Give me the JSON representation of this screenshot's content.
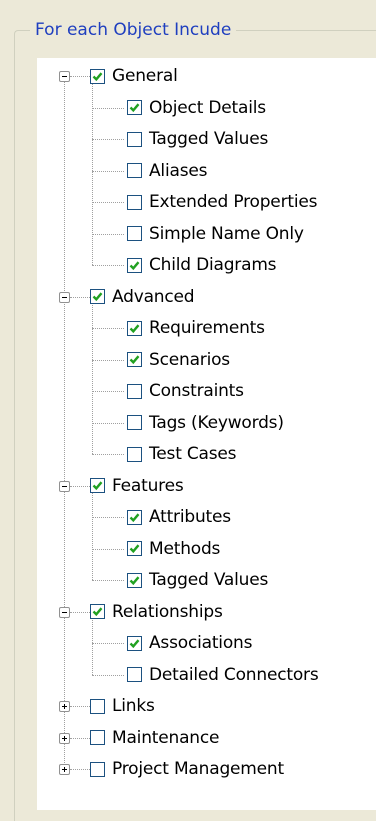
{
  "group": {
    "title": "For each Object Incude"
  },
  "tree": [
    {
      "label": "General",
      "checked": true,
      "expanded": true,
      "children": [
        {
          "label": "Object Details",
          "checked": true
        },
        {
          "label": "Tagged Values",
          "checked": false
        },
        {
          "label": "Aliases",
          "checked": false
        },
        {
          "label": "Extended Properties",
          "checked": false
        },
        {
          "label": "Simple Name Only",
          "checked": false
        },
        {
          "label": "Child Diagrams",
          "checked": true
        }
      ]
    },
    {
      "label": "Advanced",
      "checked": true,
      "expanded": true,
      "children": [
        {
          "label": "Requirements",
          "checked": true
        },
        {
          "label": "Scenarios",
          "checked": true
        },
        {
          "label": "Constraints",
          "checked": false
        },
        {
          "label": "Tags (Keywords)",
          "checked": false
        },
        {
          "label": "Test Cases",
          "checked": false
        }
      ]
    },
    {
      "label": "Features",
      "checked": true,
      "expanded": true,
      "children": [
        {
          "label": "Attributes",
          "checked": true
        },
        {
          "label": "Methods",
          "checked": true
        },
        {
          "label": "Tagged Values",
          "checked": true
        }
      ]
    },
    {
      "label": "Relationships",
      "checked": true,
      "expanded": true,
      "children": [
        {
          "label": "Associations",
          "checked": true
        },
        {
          "label": "Detailed Connectors",
          "checked": false
        }
      ]
    },
    {
      "label": "Links",
      "checked": false,
      "expanded": false,
      "children": []
    },
    {
      "label": "Maintenance",
      "checked": false,
      "expanded": false,
      "children": []
    },
    {
      "label": "Project Management",
      "checked": false,
      "expanded": false,
      "children": []
    }
  ],
  "colors": {
    "checkmark": "#21a121",
    "checkbox_border": "#1c5180",
    "group_title": "#1f3fbf"
  }
}
